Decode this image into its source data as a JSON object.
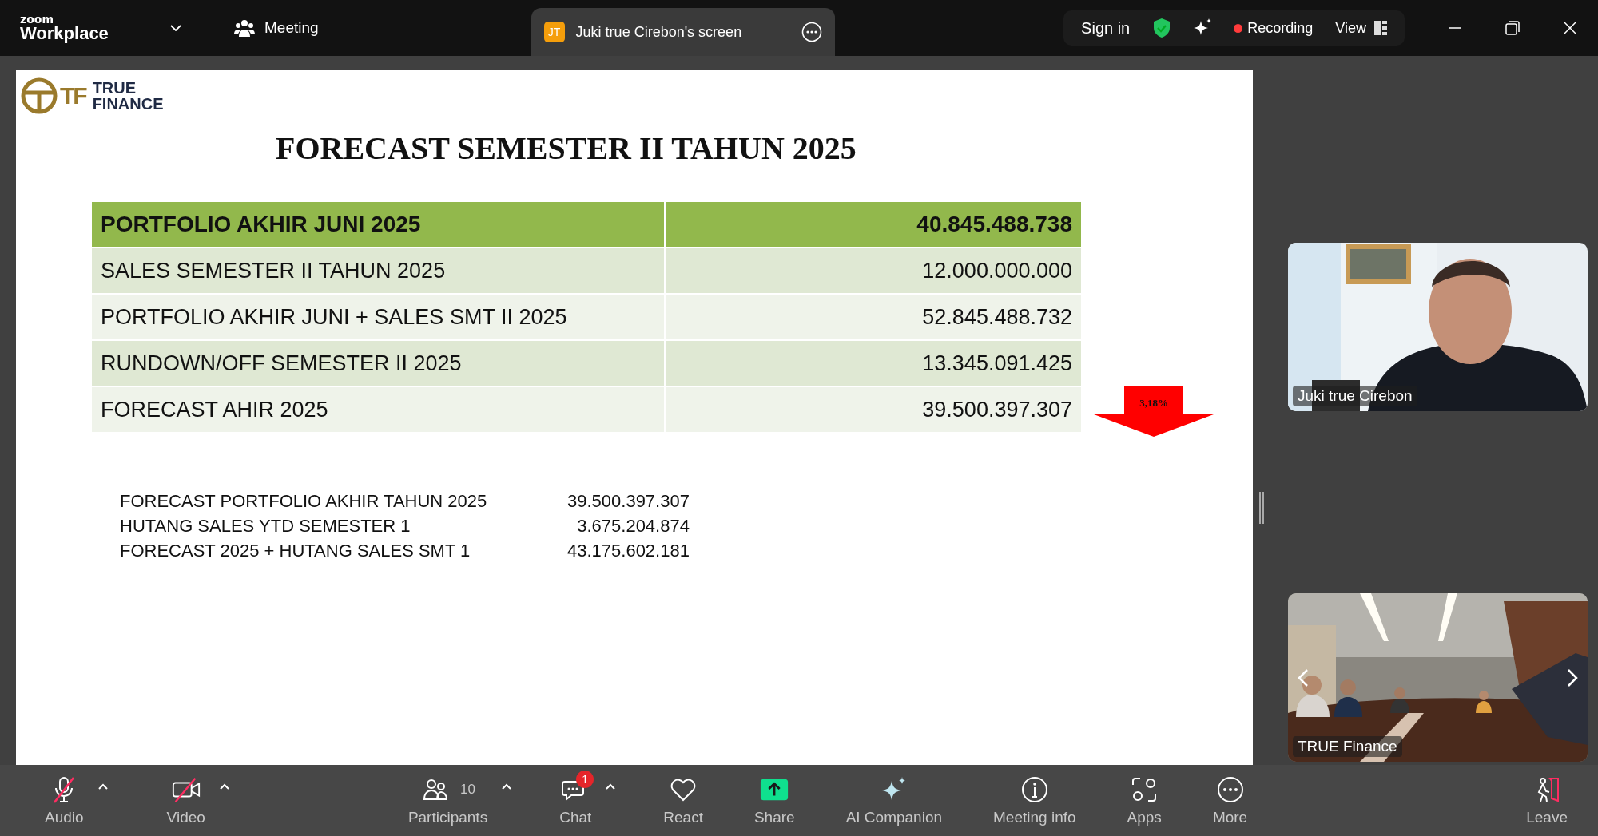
{
  "app": {
    "brand_small": "zoom",
    "brand": "Workplace",
    "meeting_label": "Meeting"
  },
  "share_tab": {
    "initials": "JT",
    "title": "Juki true Cirebon's screen"
  },
  "header_actions": {
    "sign_in": "Sign in",
    "recording": true,
    "recording_label": "Recording",
    "view_label": "View"
  },
  "slide": {
    "logo": {
      "monogram": "TF",
      "line1": "TRUE",
      "line2": "FINANCE"
    },
    "title": "FORECAST SEMESTER II TAHUN 2025",
    "table": [
      {
        "label": "PORTFOLIO AKHIR JUNI 2025",
        "value": "40.845.488.738",
        "kind": "header"
      },
      {
        "label": "SALES SEMESTER II TAHUN 2025",
        "value": "12.000.000.000",
        "kind": "dark"
      },
      {
        "label": "PORTFOLIO AKHIR JUNI + SALES SMT II 2025",
        "value": "52.845.488.732",
        "kind": "light"
      },
      {
        "label": "RUNDOWN/OFF SEMESTER II 2025",
        "value": "13.345.091.425",
        "kind": "dark"
      },
      {
        "label": "FORECAST AHIR 2025",
        "value": "39.500.397.307",
        "kind": "light"
      }
    ],
    "decline": "3,18%",
    "summary": [
      {
        "label": "FORECAST PORTFOLIO AKHIR TAHUN 2025",
        "value": "39.500.397.307"
      },
      {
        "label": "HUTANG SALES YTD SEMESTER 1",
        "value": "3.675.204.874"
      },
      {
        "label": "FORECAST 2025 + HUTANG SALES SMT 1",
        "value": "43.175.602.181"
      }
    ]
  },
  "videos": [
    {
      "name": "Juki true Cirebon",
      "kind": "office"
    },
    {
      "name": "TRUE Finance",
      "kind": "room"
    }
  ],
  "toolbar": {
    "left": [
      {
        "kind": "audio",
        "label": "Audio",
        "muted": true,
        "menu": true
      },
      {
        "kind": "video",
        "label": "Video",
        "muted": true,
        "menu": true
      }
    ],
    "center": [
      {
        "kind": "participants",
        "label": "Participants",
        "count": "10",
        "menu": true
      },
      {
        "kind": "chat",
        "label": "Chat",
        "badge": "1",
        "menu": true
      },
      {
        "kind": "react",
        "label": "React"
      },
      {
        "kind": "share",
        "label": "Share"
      },
      {
        "kind": "ai",
        "label": "AI Companion"
      },
      {
        "kind": "info",
        "label": "Meeting info"
      },
      {
        "kind": "apps",
        "label": "Apps"
      },
      {
        "kind": "more",
        "label": "More"
      }
    ],
    "right": [
      {
        "kind": "leave",
        "label": "Leave"
      }
    ]
  }
}
